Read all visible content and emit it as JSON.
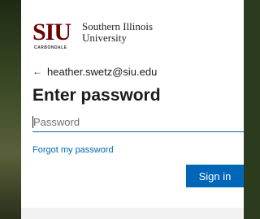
{
  "logo": {
    "mark": "SIU",
    "sub": "CARBONDALE",
    "name_line1": "Southern Illinois",
    "name_line2": "University"
  },
  "account": {
    "back_icon": "left-arrow-icon",
    "email": "heather.swetz@siu.edu"
  },
  "title": "Enter password",
  "password": {
    "placeholder": "Password",
    "value": ""
  },
  "forgot_link": "Forgot my password",
  "sign_in_label": "Sign in",
  "colors": {
    "accent": "#0067b8",
    "brand": "#720000",
    "text": "#1b1b1b"
  }
}
